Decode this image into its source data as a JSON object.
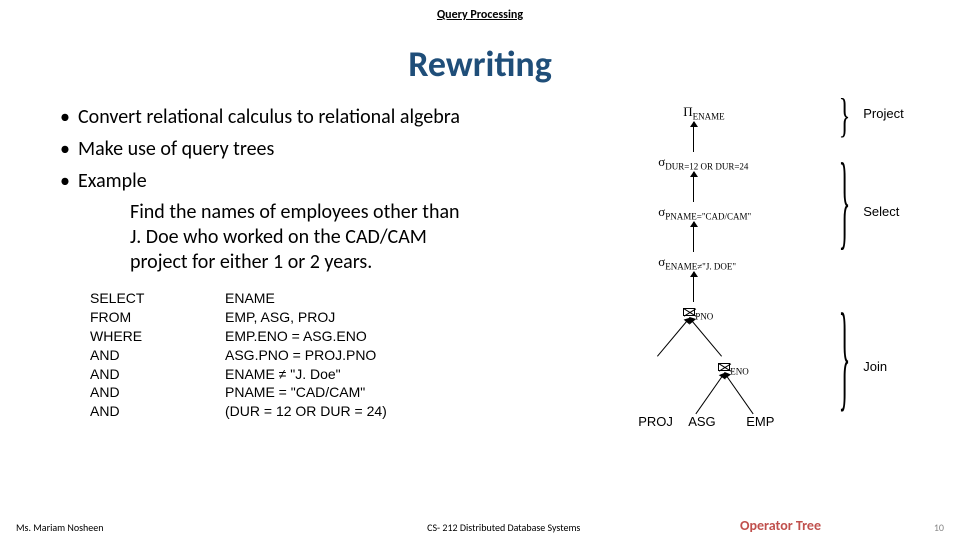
{
  "header": "Query Processing",
  "title": "Rewriting",
  "bullets": {
    "b1": "Convert relational calculus to relational algebra",
    "b2": "Make use of query trees",
    "b3": "Example"
  },
  "example": "Find the names of employees other   than J. Doe who worked on the CAD/CAM project for  either 1 or 2 years.",
  "sql": {
    "rows": [
      {
        "kw": "SELECT",
        "val": "ENAME"
      },
      {
        "kw": "FROM",
        "val": "EMP, ASG, PROJ"
      },
      {
        "kw": "WHERE",
        "val": "EMP.ENO = ASG.ENO"
      },
      {
        "kw": "AND",
        "val": "ASG.PNO = PROJ.PNO"
      },
      {
        "kw": "AND",
        "val": "ENAME ≠ \"J. Doe\""
      },
      {
        "kw": "AND",
        "val": "PNAME = \"CAD/CAM\""
      },
      {
        "kw": "AND",
        "val": "(DUR = 12 OR DUR = 24)"
      }
    ]
  },
  "tree": {
    "pi_sub": "ENAME",
    "sigma1_sub": "DUR=12 OR DUR=24",
    "sigma2_sub": "PNAME=\"CAD/CAM\"",
    "sigma3_sub": "ENAME≠\"J. DOE\"",
    "join1_sub": "PNO",
    "join2_sub": "ENO",
    "leaf1": "PROJ",
    "leaf2": "ASG",
    "leaf3": "EMP",
    "label_project": "Project",
    "label_select": "Select",
    "label_join": "Join",
    "caption": "Operator Tree"
  },
  "footer": {
    "left": "Ms. Mariam Nosheen",
    "center": "CS- 212 Distributed Database Systems",
    "page": "10"
  }
}
